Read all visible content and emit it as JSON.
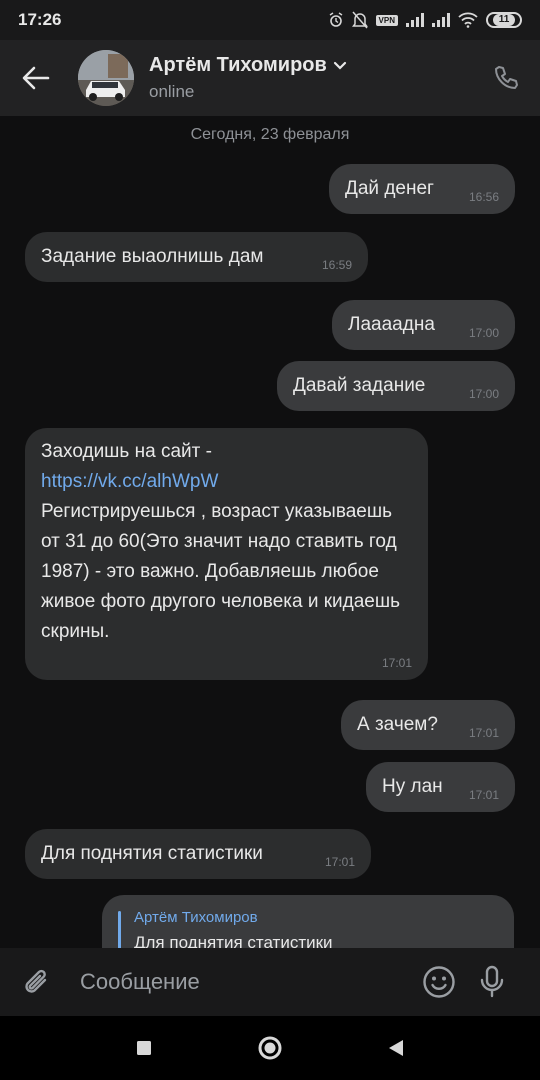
{
  "status_bar": {
    "time": "17:26",
    "vpn": "VPN",
    "battery": "11"
  },
  "header": {
    "contact_name": "Артём Тихомиров",
    "contact_status": "online"
  },
  "chat": {
    "date_separator": "Сегодня, 23 февраля",
    "messages": [
      {
        "direction": "out",
        "text": "Дай денег",
        "time": "16:56"
      },
      {
        "direction": "in",
        "text": "Задание выаолнишь дам",
        "time": "16:59"
      },
      {
        "direction": "out",
        "text": "Лаааадна",
        "time": "17:00"
      },
      {
        "direction": "out",
        "text": "Давай задание",
        "time": "17:00"
      },
      {
        "direction": "in",
        "text_before_link": "Заходишь на сайт -",
        "link": "https://vk.cc/alhWpW",
        "text_after_link": "Регистрируешься , возраст указываешь от 31 до 60(Это значит надо ставить год 1987) - это важно. Добавляешь любое живое фото другого человека и кидаешь скрины.",
        "time": "17:01"
      },
      {
        "direction": "out",
        "text": "А зачем?",
        "time": "17:01"
      },
      {
        "direction": "out",
        "text": "Ну лан",
        "time": "17:01"
      },
      {
        "direction": "in",
        "text": "Для поднятия статистики",
        "time": "17:01"
      }
    ],
    "reply": {
      "author": "Артём Тихомиров",
      "quoted_text": "Для поднятия статистики"
    }
  },
  "composer": {
    "placeholder": "Сообщение"
  },
  "icons": {
    "back": "arrow-left-icon",
    "call": "phone-icon",
    "attach": "paperclip-icon",
    "emoji": "smile-icon",
    "mic": "microphone-icon",
    "nav_recent": "square-icon",
    "nav_home": "circle-icon",
    "nav_back": "triangle-icon"
  },
  "colors": {
    "link": "#71aaeb",
    "bubble_in": "#2c2d2e",
    "bubble_out": "#3a3b3d",
    "background": "#0f0f10"
  }
}
